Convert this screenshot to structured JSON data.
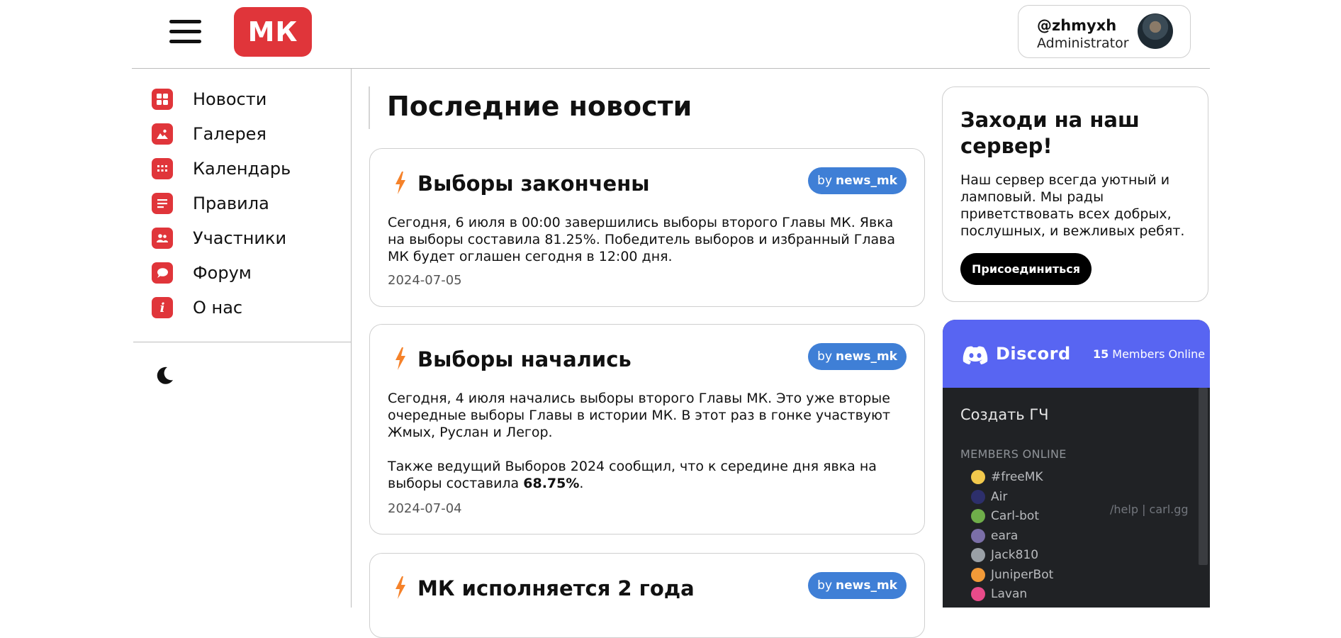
{
  "header": {
    "logo_text": "МК",
    "user": {
      "username": "@zhmyxh",
      "role": "Administrator"
    }
  },
  "sidebar": {
    "items": [
      {
        "label": "Новости",
        "icon": "grid-icon"
      },
      {
        "label": "Галерея",
        "icon": "image-icon"
      },
      {
        "label": "Календарь",
        "icon": "calendar-icon"
      },
      {
        "label": "Правила",
        "icon": "document-icon"
      },
      {
        "label": "Участники",
        "icon": "users-icon"
      },
      {
        "label": "Форум",
        "icon": "chat-bubble-icon"
      },
      {
        "label": "О нас",
        "icon": "info-icon"
      }
    ],
    "theme_toggle_icon": "moon-icon"
  },
  "main": {
    "title": "Последние новости",
    "posts": [
      {
        "title": "Выборы закончены",
        "by": "by",
        "author": "news_mk",
        "body_p1": "Сегодня, 6 июля в 00:00 завершились выборы второго Главы МК. Явка на выборы составила 81.25%. Победитель выборов и избранный Глава МК будет оглашен сегодня в 12:00 дня.",
        "date": "2024-07-05"
      },
      {
        "title": "Выборы начались",
        "by": "by",
        "author": "news_mk",
        "body_p1": "Сегодня, 4 июля начались выборы второго Главы МК. Это уже вторые очередные выборы Главы в истории МК. В этот раз в гонке участвуют Жмых, Руслан и Легор.",
        "body_p2_prefix": "Также ведущий Выборов 2024 сообщил, что к середине дня явка на выборы составила ",
        "body_p2_bold": "68.75%",
        "body_p2_suffix": ".",
        "date": "2024-07-04"
      },
      {
        "title": "МК исполняется 2 года",
        "by": "by",
        "author": "news_mk"
      }
    ]
  },
  "promo": {
    "title": "Заходи на наш сервер!",
    "text": "Наш сервер всегда уютный и ламповый. Мы рады приветствовать всех добрых, послушных, и вежливых ребят.",
    "button": "Присоединиться"
  },
  "discord": {
    "brand": "Discord",
    "online_count": "15",
    "online_label": "Members Online",
    "channel": "Создать ГЧ",
    "section_title": "MEMBERS ONLINE",
    "members": [
      {
        "name": "#freeMK",
        "color": "#f2c94c"
      },
      {
        "name": "Air",
        "color": "#2d2f6b"
      },
      {
        "name": "Carl-bot",
        "color": "#6fae4a"
      },
      {
        "name": "eara",
        "color": "#7b6fa8"
      },
      {
        "name": "Jack810",
        "color": "#9aa0a6"
      },
      {
        "name": "JuniperBot",
        "color": "#f29a38"
      },
      {
        "name": "Lavan",
        "color": "#e84b8a"
      }
    ],
    "game_text": "/help | carl.gg"
  },
  "colors": {
    "accent": "#e0353a",
    "author_badge": "#3f7fd6",
    "discord": "#5865f2",
    "bolt": "#f5822a"
  }
}
